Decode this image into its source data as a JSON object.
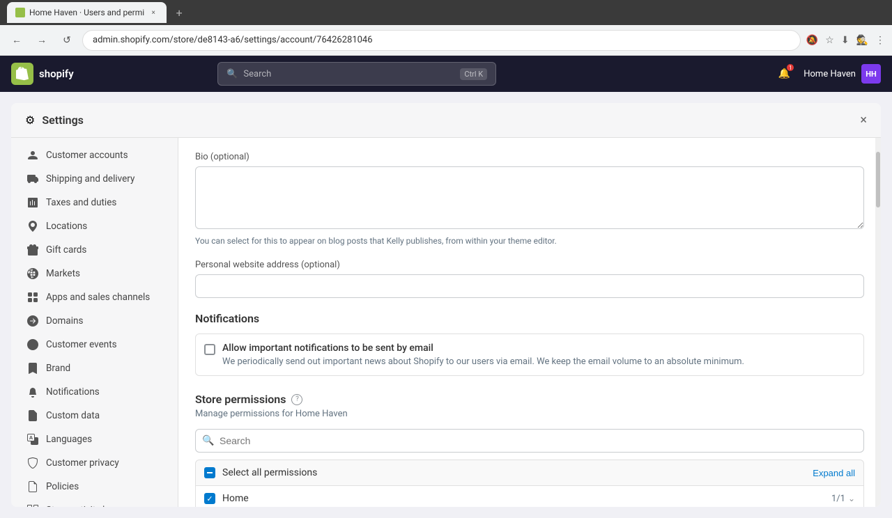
{
  "browser": {
    "tab_title": "Home Haven · Users and permi",
    "url": "admin.shopify.com/store/de8143-a6/settings/account/76426281046",
    "new_tab_label": "+",
    "nav": {
      "back": "←",
      "forward": "→",
      "refresh": "↺"
    }
  },
  "shopify_header": {
    "logo_text": "shopify",
    "logo_letter": "S",
    "search_placeholder": "Search",
    "search_shortcut": "Ctrl K",
    "store_name": "Home Haven",
    "store_initials": "HH",
    "notification_count": "1"
  },
  "settings": {
    "title": "Settings",
    "close_label": "×",
    "sidebar": {
      "items": [
        {
          "id": "customer-accounts",
          "label": "Customer accounts",
          "icon": "person"
        },
        {
          "id": "shipping-delivery",
          "label": "Shipping and delivery",
          "icon": "shipping"
        },
        {
          "id": "taxes-duties",
          "label": "Taxes and duties",
          "icon": "taxes"
        },
        {
          "id": "locations",
          "label": "Locations",
          "icon": "location"
        },
        {
          "id": "gift-cards",
          "label": "Gift cards",
          "icon": "gift"
        },
        {
          "id": "markets",
          "label": "Markets",
          "icon": "markets"
        },
        {
          "id": "apps-sales-channels",
          "label": "Apps and sales channels",
          "icon": "apps"
        },
        {
          "id": "domains",
          "label": "Domains",
          "icon": "domains"
        },
        {
          "id": "customer-events",
          "label": "Customer events",
          "icon": "events"
        },
        {
          "id": "brand",
          "label": "Brand",
          "icon": "brand"
        },
        {
          "id": "notifications",
          "label": "Notifications",
          "icon": "notifications"
        },
        {
          "id": "custom-data",
          "label": "Custom data",
          "icon": "custom-data"
        },
        {
          "id": "languages",
          "label": "Languages",
          "icon": "languages"
        },
        {
          "id": "customer-privacy",
          "label": "Customer privacy",
          "icon": "privacy"
        },
        {
          "id": "policies",
          "label": "Policies",
          "icon": "policies"
        },
        {
          "id": "store-activity-log",
          "label": "Store activity log",
          "icon": "activity"
        }
      ]
    },
    "content": {
      "bio_label": "Bio (optional)",
      "bio_value": "",
      "bio_helper": "You can select for this to appear on blog posts that Kelly publishes, from within your theme editor.",
      "website_label": "Personal website address (optional)",
      "website_value": "",
      "notifications_section_title": "Notifications",
      "notifications_checkbox_label": "Allow important notifications to be sent by email",
      "notifications_checkbox_desc": "We periodically send out important news about Shopify to our users via email. We keep the email volume to an absolute minimum.",
      "store_permissions_title": "Store permissions",
      "store_permissions_info_icon": "?",
      "store_permissions_subtitle": "Manage permissions for Home Haven",
      "search_permissions_placeholder": "Search",
      "select_all_label": "Select all permissions",
      "expand_all_label": "Expand all",
      "home_label": "Home",
      "home_count": "1/1",
      "chevron": "⌄"
    }
  }
}
